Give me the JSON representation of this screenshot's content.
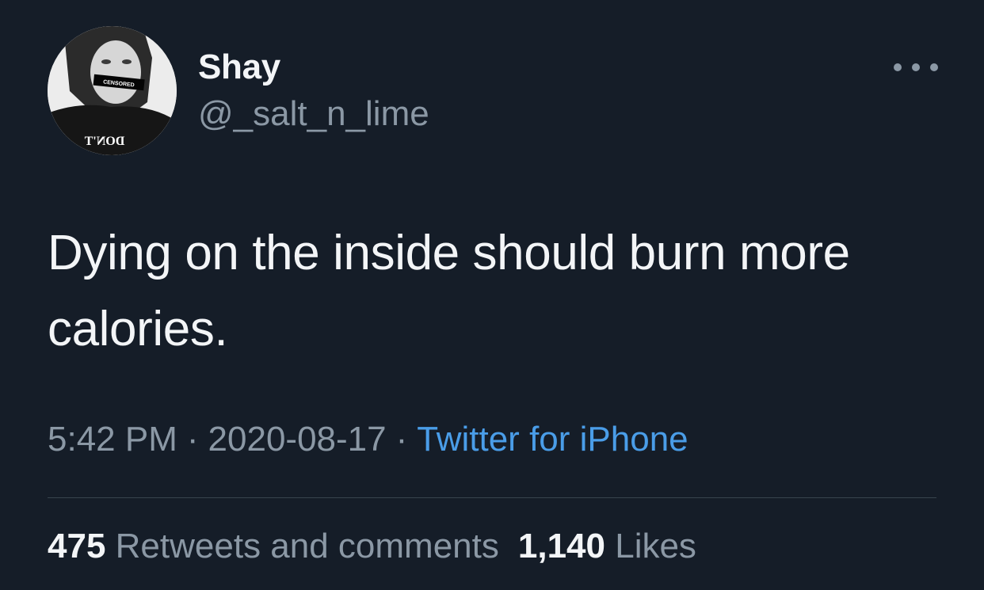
{
  "user": {
    "display_name": "Shay",
    "handle": "@_salt_n_lime",
    "avatar_censor_text": "CENSORED",
    "avatar_shirt_text": "DON'T"
  },
  "tweet": {
    "text": "Dying on the inside should burn more calories."
  },
  "meta": {
    "time": "5:42 PM",
    "separator": "·",
    "date": "2020-08-17",
    "source": "Twitter for iPhone"
  },
  "stats": {
    "retweets_count": "475",
    "retweets_label": "Retweets and comments",
    "likes_count": "1,140",
    "likes_label": "Likes"
  },
  "icons": {
    "more": "more-horizontal-icon"
  },
  "colors": {
    "background": "#151d28",
    "primary_text": "#f3f5f7",
    "secondary_text": "#8b98a5",
    "link": "#4a9de8",
    "divider": "#38444d"
  }
}
